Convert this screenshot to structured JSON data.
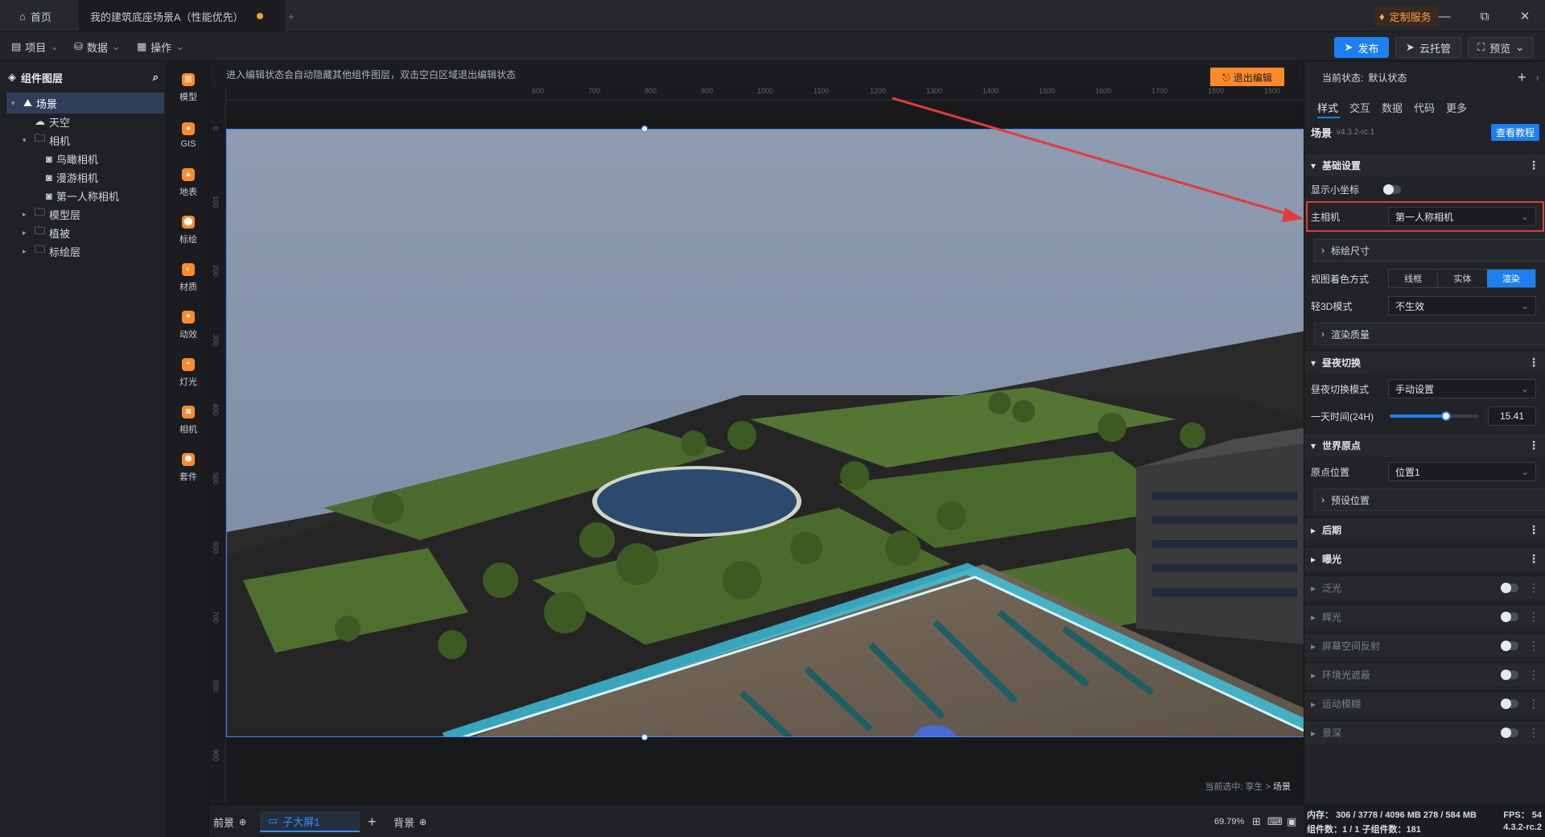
{
  "titlebar": {
    "home_tab": "首页",
    "doc_tab": "我的建筑底座场景A（性能优先）",
    "new_tab": "+",
    "custom_service": "定制服务",
    "minimize": "—",
    "restore": "⧉",
    "close": "✕"
  },
  "toolbar": {
    "menus": [
      "项目",
      "数据",
      "操作"
    ],
    "publish": "发布",
    "cloud_host": "云托管",
    "preview": "预览"
  },
  "layers": {
    "title": "组件图层",
    "items": [
      {
        "label": "场景",
        "level": 0,
        "icon": "scene-icon",
        "expanded": true,
        "selected": true
      },
      {
        "label": "天空",
        "level": 1,
        "icon": "sky-icon"
      },
      {
        "label": "相机",
        "level": 1,
        "icon": "folder-icon",
        "expanded": true
      },
      {
        "label": "鸟瞰相机",
        "level": 2,
        "icon": "camera-icon"
      },
      {
        "label": "漫游相机",
        "level": 2,
        "icon": "camera-icon"
      },
      {
        "label": "第一人称相机",
        "level": 2,
        "icon": "camera-icon"
      },
      {
        "label": "模型层",
        "level": 1,
        "icon": "folder-icon",
        "expanded": false
      },
      {
        "label": "植被",
        "level": 1,
        "icon": "folder-icon",
        "expanded": false
      },
      {
        "label": "标绘层",
        "level": 1,
        "icon": "folder-icon",
        "expanded": false
      }
    ]
  },
  "iconbar": [
    {
      "label": "模型",
      "icon": "model-icon"
    },
    {
      "label": "GIS",
      "icon": "gis-icon"
    },
    {
      "label": "地表",
      "icon": "terrain-icon"
    },
    {
      "label": "标绘",
      "icon": "marker-icon"
    },
    {
      "label": "材质",
      "icon": "material-icon"
    },
    {
      "label": "动效",
      "icon": "effect-icon"
    },
    {
      "label": "灯光",
      "icon": "light-icon"
    },
    {
      "label": "相机",
      "icon": "camera-icon"
    },
    {
      "label": "套件",
      "icon": "kit-icon"
    }
  ],
  "canvas": {
    "info": "进入编辑状态会自动隐藏其他组件图层，双击空白区域退出编辑状态",
    "exit_edit": "退出编辑",
    "breadcrumb_prefix": "当前选中:",
    "breadcrumb_parent": "孪生",
    "breadcrumb_current": "场景",
    "ruler_top": [
      "600",
      "700",
      "800",
      "900",
      "1000",
      "1100",
      "1200",
      "1300",
      "1400",
      "1500",
      "1600",
      "1700",
      "1800",
      "1900"
    ],
    "ruler_left": [
      "0",
      "100",
      "200",
      "300",
      "400",
      "500",
      "600",
      "700",
      "800",
      "900"
    ]
  },
  "bottombar": {
    "front": "前景",
    "screen": "子大屏1",
    "add": "+",
    "back": "背景",
    "zoom": "69.79%"
  },
  "props": {
    "state_label": "当前状态:",
    "state_value": "默认状态",
    "tabs": [
      "样式",
      "交互",
      "数据",
      "代码",
      "更多"
    ],
    "component": "场景",
    "version": "v4.3.2-rc.1",
    "tutorial": "查看教程",
    "basic": "基础设置",
    "show_axes": "显示小坐标",
    "main_camera": "主相机",
    "main_camera_value": "第一人称相机",
    "marker_size": "标绘尺寸",
    "shading": "视图着色方式",
    "shading_opts": [
      "线框",
      "实体",
      "渲染"
    ],
    "light3d": "轻3D模式",
    "light3d_value": "不生效",
    "render_quality": "渲染质量",
    "daynight": "昼夜切换",
    "daynight_mode": "昼夜切换模式",
    "daynight_mode_value": "手动设置",
    "day_time": "一天时间(24H)",
    "day_time_value": "15.41",
    "day_time_fraction": 0.64,
    "world_origin": "世界原点",
    "origin_pos": "原点位置",
    "origin_pos_value": "位置1",
    "preset_pos": "预设位置",
    "post": "后期",
    "exposure": "曝光",
    "effects": [
      "泛光",
      "辉光",
      "屏幕空间反射",
      "环境光遮蔽",
      "运动模糊",
      "景深"
    ]
  },
  "status": {
    "memory": "内存： 306 / 3778 / 4096 MB  278 / 584 MB",
    "fps": "FPS：  54",
    "components": "组件数：1 / 1   子组件数：181",
    "version": "4.3.2-rc.2"
  },
  "colors": {
    "accent": "#1e7ff0",
    "orange": "#ff8a2b",
    "arrow": "#e23b3b"
  }
}
